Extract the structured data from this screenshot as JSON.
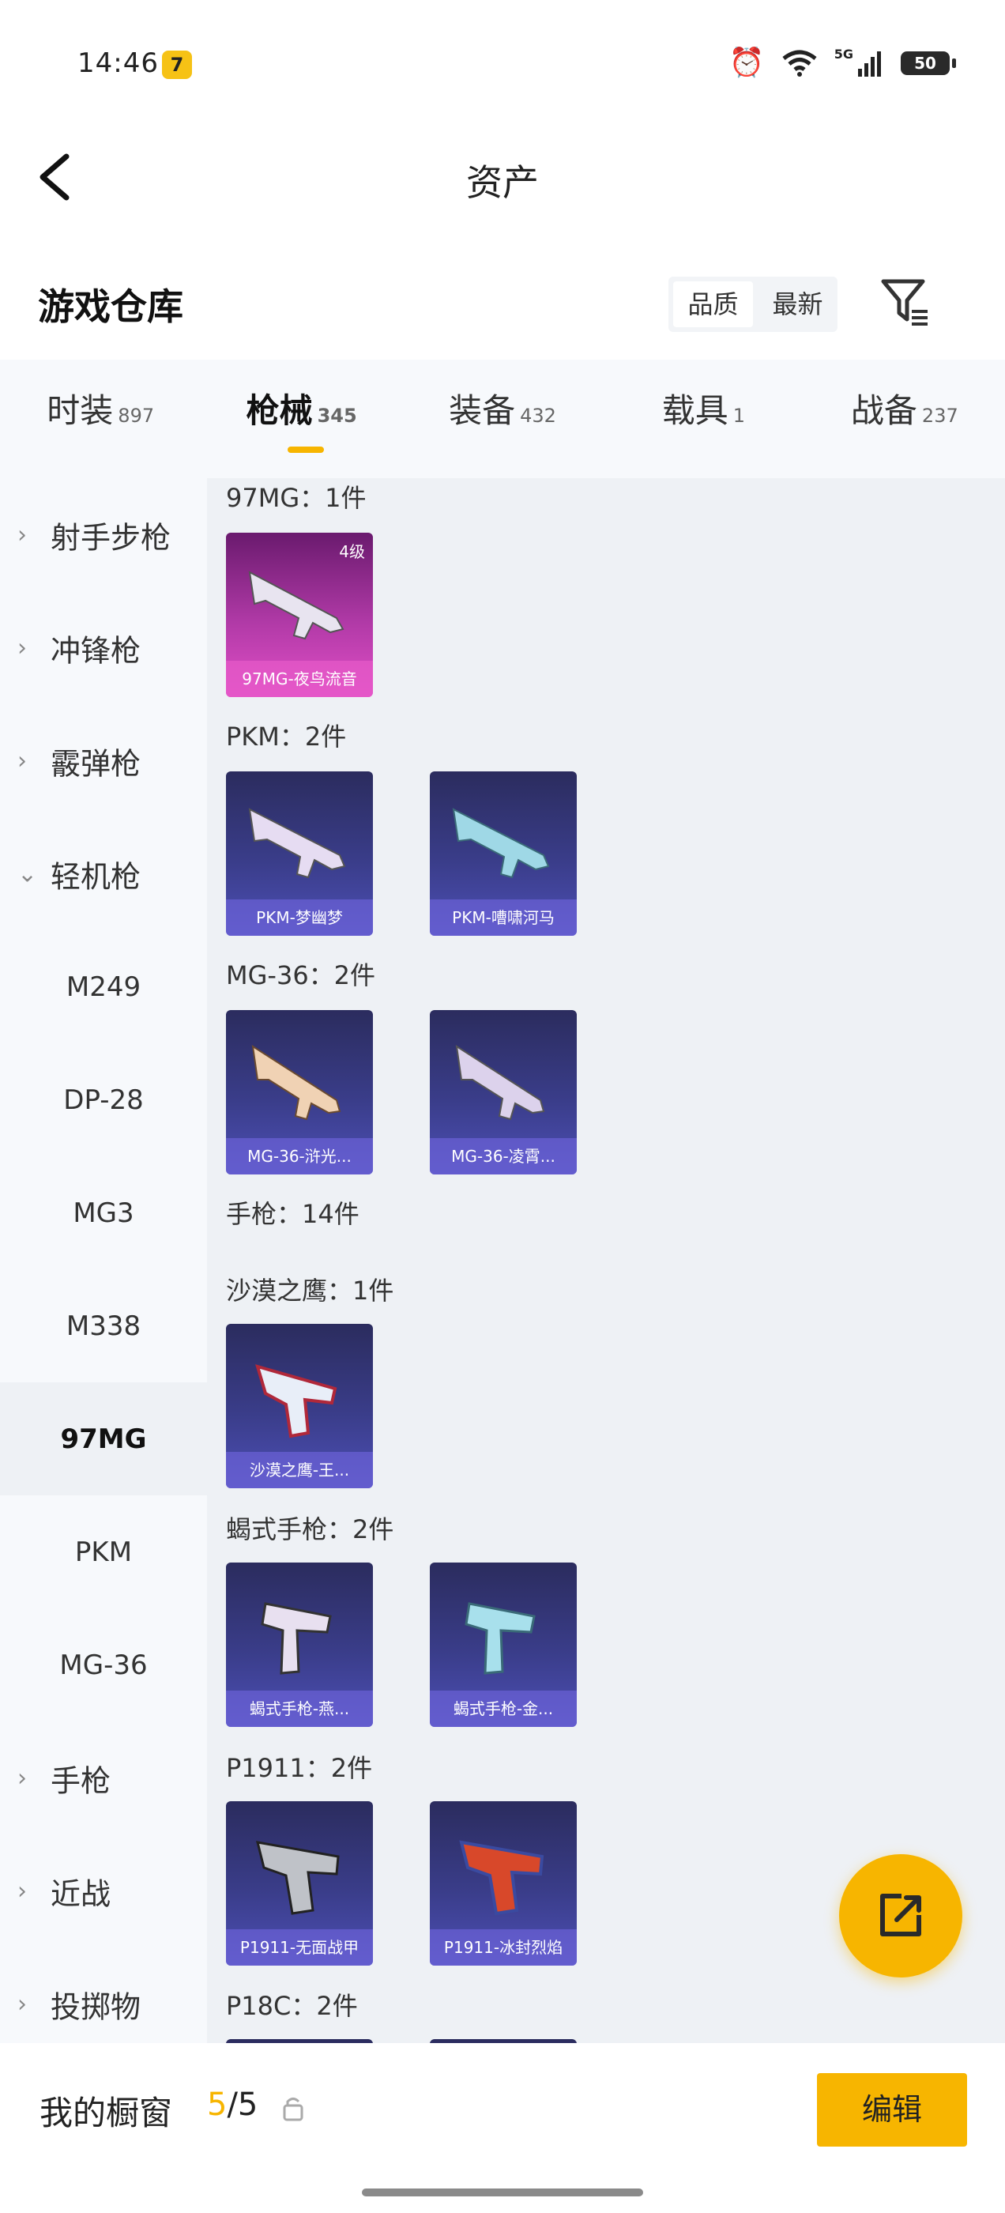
{
  "status_bar": {
    "time": "14:46",
    "app_badge": "7",
    "network": "5G",
    "battery": "50"
  },
  "nav": {
    "title": "资产"
  },
  "section": {
    "title": "游戏仓库",
    "sort_options": [
      "品质",
      "最新"
    ],
    "sort_active": "品质"
  },
  "tabs": [
    {
      "label": "时装",
      "count": "897"
    },
    {
      "label": "枪械",
      "count": "345"
    },
    {
      "label": "装备",
      "count": "432"
    },
    {
      "label": "载具",
      "count": "1"
    },
    {
      "label": "战备",
      "count": "237"
    }
  ],
  "active_tab": "枪械",
  "sidebar": {
    "items": [
      {
        "label": "射手步枪"
      },
      {
        "label": "冲锋枪"
      },
      {
        "label": "霰弹枪"
      },
      {
        "label": "轻机枪"
      },
      {
        "label": "M249"
      },
      {
        "label": "DP-28"
      },
      {
        "label": "MG3"
      },
      {
        "label": "M338"
      },
      {
        "label": "97MG"
      },
      {
        "label": "PKM"
      },
      {
        "label": "MG-36"
      },
      {
        "label": "手枪"
      },
      {
        "label": "近战"
      },
      {
        "label": "投掷物"
      }
    ]
  },
  "content": {
    "groups": [
      {
        "header": "97MG：1件",
        "items": [
          {
            "name": "97MG-夜鸟流音",
            "level": "4级"
          }
        ]
      },
      {
        "header": "PKM：2件",
        "items": [
          {
            "name": "PKM-梦幽梦"
          },
          {
            "name": "PKM-嘈啸河马"
          }
        ]
      },
      {
        "header": "MG-36：2件",
        "items": [
          {
            "name": "MG-36-浒光..."
          },
          {
            "name": "MG-36-凌霄..."
          }
        ]
      },
      {
        "header": "手枪：14件"
      },
      {
        "header": "沙漠之鹰：1件",
        "items": [
          {
            "name": "沙漠之鹰-王..."
          }
        ]
      },
      {
        "header": "蝎式手枪：2件",
        "items": [
          {
            "name": "蝎式手枪-燕..."
          },
          {
            "name": "蝎式手枪-金..."
          }
        ]
      },
      {
        "header": "P1911：2件",
        "items": [
          {
            "name": "P1911-无面战甲"
          },
          {
            "name": "P1911-冰封烈焰"
          }
        ]
      },
      {
        "header": "P18C：2件"
      }
    ]
  },
  "bottom_bar": {
    "showcase_label": "我的橱窗",
    "showcase_current": "5",
    "showcase_total": "/5",
    "edit_label": "编辑"
  },
  "colors": {
    "accent": "#f7b500",
    "card_purple": "#3a3d8a",
    "card_pink": "#e24fc7",
    "content_bg": "#eef1f5"
  },
  "icons": [
    "back-chevron-icon",
    "filter-icon",
    "share-export-icon",
    "lock-icon",
    "alarm-icon",
    "wifi-icon",
    "signal-icon",
    "battery-icon"
  ]
}
